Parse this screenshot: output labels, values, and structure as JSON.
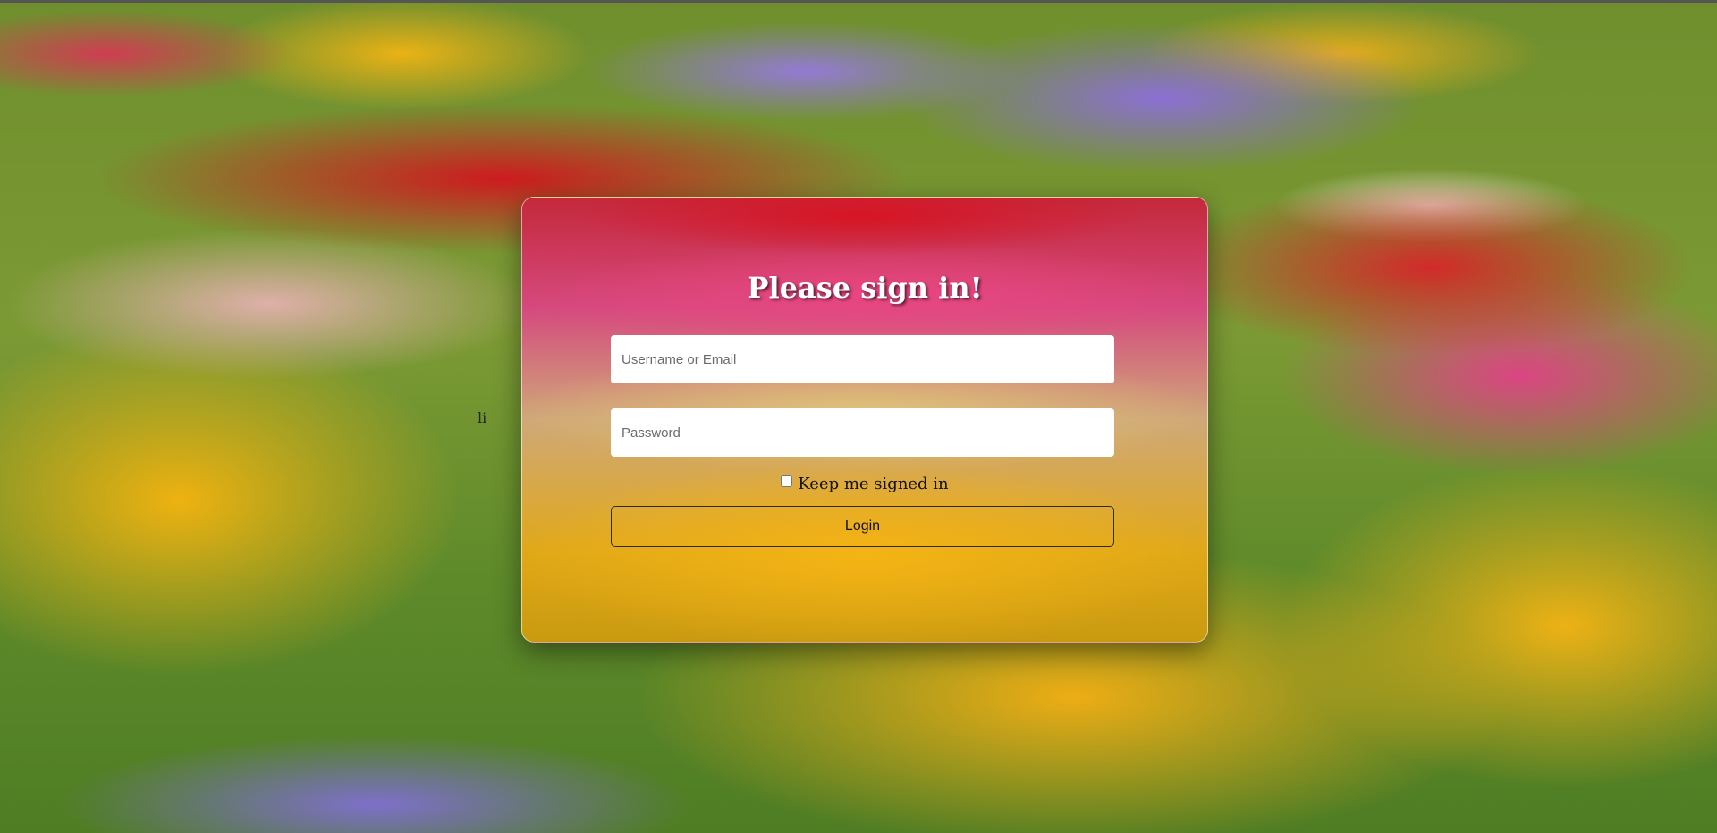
{
  "background": {
    "description_icon": "flower-field-image"
  },
  "stray_text": "li",
  "login_card": {
    "title": "Please sign in!",
    "username_placeholder": "Username or Email",
    "username_value": "",
    "password_placeholder": "Password",
    "password_value": "",
    "keep_signed_in_label": "Keep me signed in",
    "keep_signed_in_checked": false,
    "login_button_label": "Login"
  }
}
